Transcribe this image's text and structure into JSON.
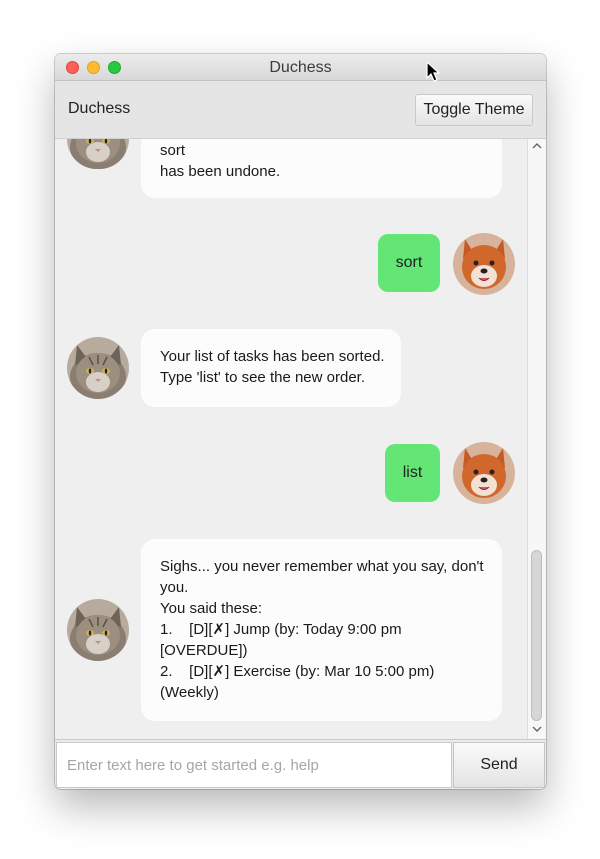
{
  "window": {
    "title": "Duchess"
  },
  "toolbar": {
    "app_name": "Duchess",
    "toggle_label": "Toggle Theme"
  },
  "messages": [
    {
      "from": "duchess",
      "lines": [
        "sort",
        "has been undone."
      ]
    },
    {
      "from": "user",
      "text": "sort"
    },
    {
      "from": "duchess",
      "lines": [
        "Your list of tasks has been sorted.",
        "Type 'list' to see the new order."
      ]
    },
    {
      "from": "user",
      "text": "list"
    },
    {
      "from": "duchess",
      "lines": [
        "Sighs... you never remember what you say, don't",
        "you.",
        "You said these:",
        "1.    [D][✗] Jump (by: Today 9:00 pm",
        "[OVERDUE])",
        "2.    [D][✗] Exercise (by: Mar 10 5:00 pm)",
        "(Weekly)"
      ]
    }
  ],
  "input": {
    "value": "",
    "placeholder": "Enter text here to get started e.g. help"
  },
  "send_label": "Send",
  "icons": {
    "duchess_avatar": "cat-avatar-icon",
    "user_avatar": "shiba-dog-avatar-icon",
    "cursor": "mouse-pointer-icon"
  },
  "colors": {
    "user_bubble": "#63e675",
    "duchess_bubble": "#fcfcfc",
    "close": "#fe5f57",
    "minimize": "#febc2e",
    "maximize": "#28c840"
  }
}
